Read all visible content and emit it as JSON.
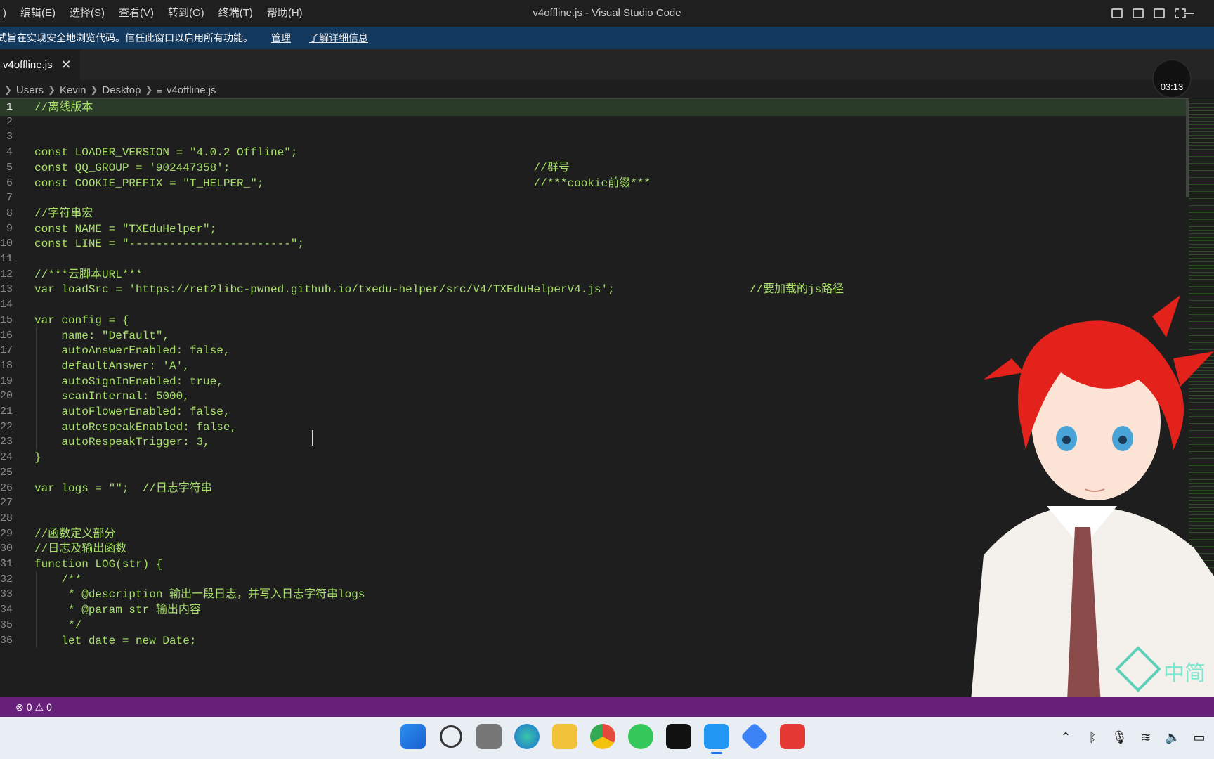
{
  "window": {
    "title": "v4offline.js - Visual Studio Code",
    "menu": ")|编辑(E)|选择(S)|查看(V)|转到(G)|终端(T)|帮助(H)"
  },
  "menu_items": [
    ")",
    "编辑(E)",
    "选择(S)",
    "查看(V)",
    "转到(G)",
    "终端(T)",
    "帮助(H)"
  ],
  "banner": {
    "message": "式旨在实现安全地浏览代码。信任此窗口以启用所有功能。",
    "manage": "管理",
    "learn_more": "了解详细信息",
    "color": "#14395e"
  },
  "tab": {
    "name": "v4offline.js",
    "close": "✕"
  },
  "breadcrumb": [
    "Users",
    "Kevin",
    "Desktop",
    "v4offline.js"
  ],
  "timer": "03:13",
  "editor": {
    "lines": [
      {
        "n": "1",
        "t": "//离线版本"
      },
      {
        "n": "2",
        "t": ""
      },
      {
        "n": "3",
        "t": ""
      },
      {
        "n": "4",
        "t": "const LOADER_VERSION = \"4.0.2 Offline\";"
      },
      {
        "n": "5",
        "t": "const QQ_GROUP = '902447358';                                             //群号"
      },
      {
        "n": "6",
        "t": "const COOKIE_PREFIX = \"T_HELPER_\";                                        //***cookie前缀***"
      },
      {
        "n": "7",
        "t": ""
      },
      {
        "n": "8",
        "t": "//字符串宏"
      },
      {
        "n": "9",
        "t": "const NAME = \"TXEduHelper\";"
      },
      {
        "n": "10",
        "t": "const LINE = \"------------------------\";"
      },
      {
        "n": "11",
        "t": ""
      },
      {
        "n": "12",
        "t": "//***云脚本URL***"
      },
      {
        "n": "13",
        "t": "var loadSrc = 'https://ret2libc-pwned.github.io/txedu-helper/src/V4/TXEduHelperV4.js';                    //要加载的js路径"
      },
      {
        "n": "14",
        "t": ""
      },
      {
        "n": "15",
        "t": "var config = {"
      },
      {
        "n": "16",
        "t": "    name: \"Default\","
      },
      {
        "n": "17",
        "t": "    autoAnswerEnabled: false,"
      },
      {
        "n": "18",
        "t": "    defaultAnswer: 'A',"
      },
      {
        "n": "19",
        "t": "    autoSignInEnabled: true,"
      },
      {
        "n": "20",
        "t": "    scanInternal: 5000,"
      },
      {
        "n": "21",
        "t": "    autoFlowerEnabled: false,"
      },
      {
        "n": "22",
        "t": "    autoRespeakEnabled: false,"
      },
      {
        "n": "23",
        "t": "    autoRespeakTrigger: 3,"
      },
      {
        "n": "24",
        "t": "}"
      },
      {
        "n": "25",
        "t": ""
      },
      {
        "n": "26",
        "t": "var logs = \"\";  //日志字符串"
      },
      {
        "n": "27",
        "t": ""
      },
      {
        "n": "28",
        "t": ""
      },
      {
        "n": "29",
        "t": "//函数定义部分"
      },
      {
        "n": "30",
        "t": "//日志及输出函数"
      },
      {
        "n": "31",
        "t": "function LOG(str) {"
      },
      {
        "n": "32",
        "t": "    /**"
      },
      {
        "n": "33",
        "t": "     * @description 输出一段日志，并写入日志字符串logs"
      },
      {
        "n": "34",
        "t": "     * @param str 输出内容"
      },
      {
        "n": "35",
        "t": "     */"
      },
      {
        "n": "36",
        "t": "    let date = new Date;"
      }
    ],
    "code_color": "#a8e06a"
  },
  "status": {
    "errors": "0",
    "warnings": "0",
    "color": "#68217a"
  },
  "watermark_text": "中简"
}
